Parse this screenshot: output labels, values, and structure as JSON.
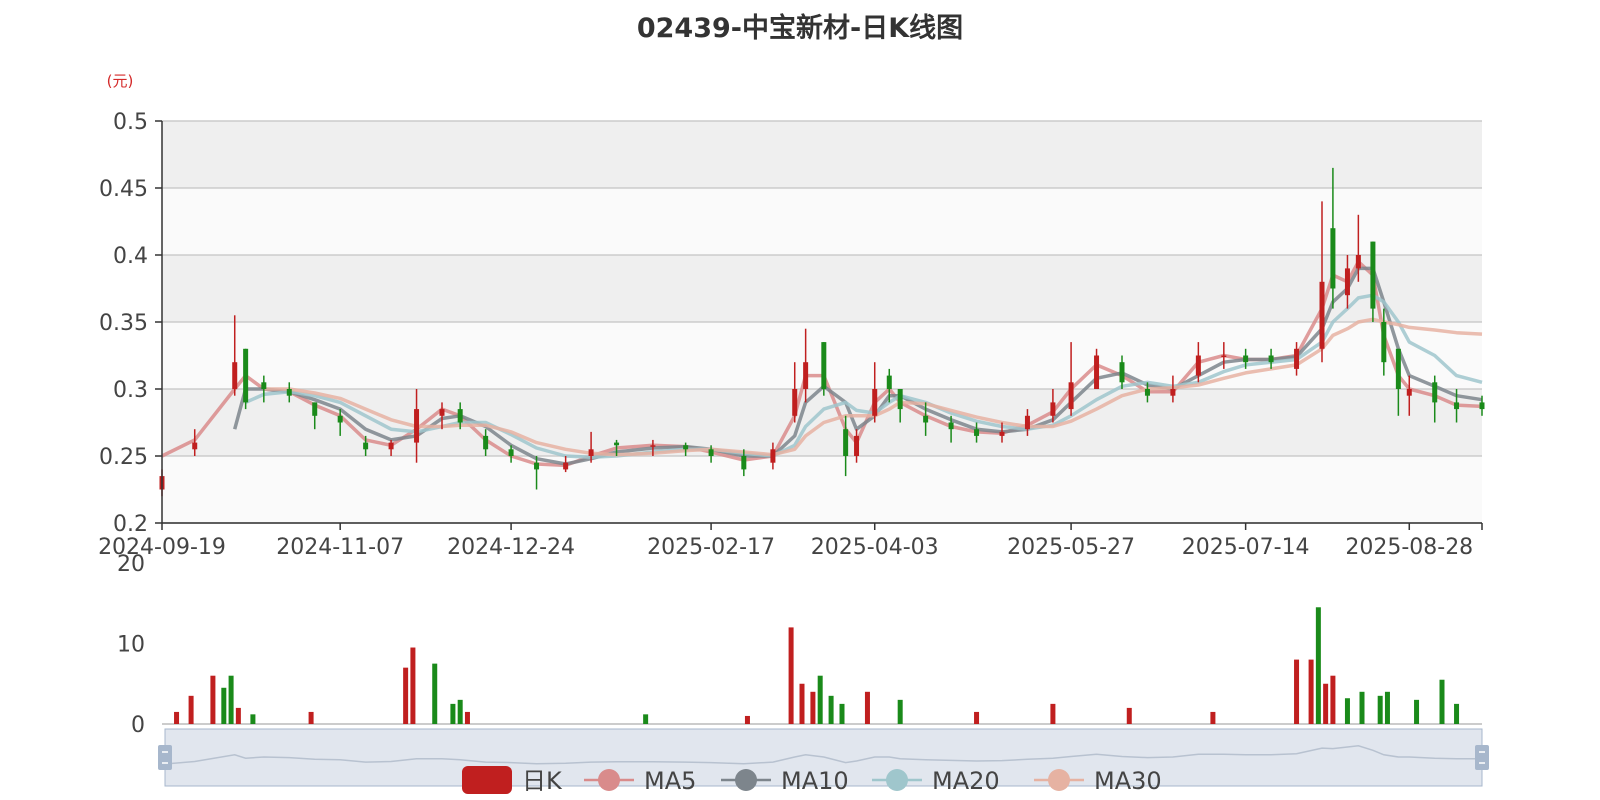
{
  "title": "02439-中宝新材-日K线图",
  "price_unit": "(元)",
  "legend": [
    "日K",
    "MA5",
    "MA10",
    "MA20",
    "MA30"
  ],
  "colors": {
    "up": "#c01f1f",
    "down": "#1a8a1a",
    "ma5": "#d98b8b",
    "ma10": "#7d858c",
    "ma20": "#9fc6cc",
    "ma30": "#e6b2a2",
    "grid": "#cccccc",
    "band_dark": "#efefef",
    "band_light": "#fafafa",
    "slider_fill": "#d9e0ea",
    "slider_handle": "#a7b7cc"
  },
  "chart_data": [
    {
      "type": "candlestick",
      "title": "02439-中宝新材-日K线图",
      "ylabel": "(元)",
      "ylim": [
        0.2,
        0.5
      ],
      "yticks": [
        "0.2",
        "0.25",
        "0.3",
        "0.35",
        "0.4",
        "0.45",
        "0.5"
      ],
      "xticks": [
        "2024-09-19",
        "2024-11-07",
        "2024-12-24",
        "2025-02-17",
        "2025-04-03",
        "2025-05-27",
        "2025-07-14",
        "2025-08-28"
      ],
      "xrange": [
        "2024-09-19",
        "2025-09-17"
      ],
      "grid": true,
      "legend_position": "bottom",
      "series": [
        {
          "name": "日K",
          "x": [
            "2024-09-19",
            "2024-09-28",
            "2024-10-09",
            "2024-10-12",
            "2024-10-17",
            "2024-10-24",
            "2024-10-31",
            "2024-11-07",
            "2024-11-14",
            "2024-11-21",
            "2024-11-28",
            "2024-12-05",
            "2024-12-10",
            "2024-12-17",
            "2024-12-24",
            "2024-12-31",
            "2025-01-08",
            "2025-01-15",
            "2025-01-22",
            "2025-02-01",
            "2025-02-10",
            "2025-02-17",
            "2025-02-26",
            "2025-03-06",
            "2025-03-12",
            "2025-03-15",
            "2025-03-20",
            "2025-03-26",
            "2025-03-29",
            "2025-04-03",
            "2025-04-07",
            "2025-04-10",
            "2025-04-17",
            "2025-04-24",
            "2025-05-01",
            "2025-05-08",
            "2025-05-15",
            "2025-05-22",
            "2025-05-27",
            "2025-06-03",
            "2025-06-10",
            "2025-06-17",
            "2025-06-24",
            "2025-07-01",
            "2025-07-08",
            "2025-07-14",
            "2025-07-21",
            "2025-07-28",
            "2025-08-04",
            "2025-08-07",
            "2025-08-11",
            "2025-08-14",
            "2025-08-18",
            "2025-08-21",
            "2025-08-25",
            "2025-08-28",
            "2025-09-04",
            "2025-09-10",
            "2025-09-17"
          ],
          "open": [
            0.225,
            0.255,
            0.3,
            0.33,
            0.305,
            0.3,
            0.29,
            0.28,
            0.26,
            0.255,
            0.26,
            0.28,
            0.285,
            0.265,
            0.255,
            0.245,
            0.24,
            0.25,
            0.26,
            0.258,
            0.258,
            0.255,
            0.25,
            0.245,
            0.28,
            0.3,
            0.335,
            0.27,
            0.25,
            0.28,
            0.31,
            0.3,
            0.28,
            0.275,
            0.27,
            0.265,
            0.27,
            0.28,
            0.285,
            0.3,
            0.32,
            0.3,
            0.295,
            0.31,
            0.325,
            0.325,
            0.325,
            0.315,
            0.33,
            0.42,
            0.37,
            0.39,
            0.41,
            0.35,
            0.33,
            0.295,
            0.305,
            0.29,
            0.29
          ],
          "close": [
            0.235,
            0.26,
            0.32,
            0.29,
            0.3,
            0.295,
            0.28,
            0.275,
            0.255,
            0.26,
            0.285,
            0.285,
            0.275,
            0.255,
            0.25,
            0.24,
            0.245,
            0.255,
            0.258,
            0.258,
            0.255,
            0.25,
            0.24,
            0.255,
            0.3,
            0.32,
            0.3,
            0.25,
            0.265,
            0.3,
            0.3,
            0.285,
            0.275,
            0.27,
            0.265,
            0.268,
            0.28,
            0.29,
            0.305,
            0.325,
            0.305,
            0.295,
            0.3,
            0.325,
            0.325,
            0.32,
            0.32,
            0.33,
            0.38,
            0.375,
            0.39,
            0.4,
            0.36,
            0.32,
            0.3,
            0.3,
            0.29,
            0.285,
            0.285
          ],
          "high": [
            0.24,
            0.27,
            0.355,
            0.33,
            0.31,
            0.305,
            0.29,
            0.285,
            0.265,
            0.262,
            0.3,
            0.29,
            0.29,
            0.27,
            0.258,
            0.25,
            0.25,
            0.268,
            0.262,
            0.262,
            0.26,
            0.258,
            0.255,
            0.26,
            0.32,
            0.345,
            0.335,
            0.28,
            0.27,
            0.32,
            0.315,
            0.3,
            0.29,
            0.28,
            0.275,
            0.275,
            0.285,
            0.3,
            0.335,
            0.33,
            0.325,
            0.305,
            0.31,
            0.335,
            0.335,
            0.33,
            0.33,
            0.335,
            0.44,
            0.465,
            0.4,
            0.43,
            0.41,
            0.36,
            0.33,
            0.31,
            0.31,
            0.3,
            0.295
          ],
          "low": [
            0.22,
            0.25,
            0.295,
            0.285,
            0.29,
            0.29,
            0.27,
            0.265,
            0.25,
            0.25,
            0.245,
            0.27,
            0.27,
            0.25,
            0.245,
            0.225,
            0.238,
            0.245,
            0.25,
            0.25,
            0.25,
            0.245,
            0.235,
            0.24,
            0.275,
            0.29,
            0.295,
            0.235,
            0.245,
            0.275,
            0.29,
            0.275,
            0.265,
            0.26,
            0.26,
            0.26,
            0.265,
            0.275,
            0.28,
            0.3,
            0.3,
            0.29,
            0.29,
            0.305,
            0.315,
            0.315,
            0.315,
            0.31,
            0.32,
            0.36,
            0.36,
            0.38,
            0.35,
            0.31,
            0.28,
            0.28,
            0.275,
            0.275,
            0.28
          ]
        },
        {
          "name": "MA5",
          "values": [
            0.25,
            0.262,
            0.3,
            0.31,
            0.3,
            0.298,
            0.288,
            0.28,
            0.262,
            0.258,
            0.27,
            0.285,
            0.28,
            0.262,
            0.25,
            0.244,
            0.243,
            0.25,
            0.256,
            0.258,
            0.257,
            0.253,
            0.247,
            0.25,
            0.28,
            0.31,
            0.31,
            0.27,
            0.26,
            0.29,
            0.3,
            0.29,
            0.28,
            0.272,
            0.268,
            0.267,
            0.273,
            0.283,
            0.3,
            0.318,
            0.31,
            0.298,
            0.298,
            0.32,
            0.325,
            0.322,
            0.322,
            0.325,
            0.36,
            0.385,
            0.38,
            0.395,
            0.385,
            0.34,
            0.31,
            0.3,
            0.295,
            0.288,
            0.287
          ]
        },
        {
          "name": "MA10",
          "values": [
            null,
            null,
            0.27,
            0.3,
            0.3,
            0.298,
            0.292,
            0.285,
            0.27,
            0.262,
            0.265,
            0.278,
            0.28,
            0.272,
            0.258,
            0.248,
            0.244,
            0.248,
            0.253,
            0.256,
            0.257,
            0.255,
            0.25,
            0.25,
            0.265,
            0.29,
            0.302,
            0.29,
            0.27,
            0.28,
            0.295,
            0.295,
            0.285,
            0.277,
            0.27,
            0.268,
            0.27,
            0.277,
            0.29,
            0.308,
            0.312,
            0.303,
            0.3,
            0.31,
            0.32,
            0.322,
            0.322,
            0.324,
            0.345,
            0.365,
            0.375,
            0.39,
            0.39,
            0.365,
            0.33,
            0.31,
            0.302,
            0.295,
            0.292
          ]
        },
        {
          "name": "MA20",
          "values": [
            null,
            null,
            null,
            0.29,
            0.296,
            0.298,
            0.295,
            0.29,
            0.28,
            0.27,
            0.268,
            0.272,
            0.275,
            0.275,
            0.266,
            0.256,
            0.25,
            0.249,
            0.25,
            0.253,
            0.255,
            0.255,
            0.252,
            0.25,
            0.258,
            0.272,
            0.285,
            0.29,
            0.284,
            0.282,
            0.29,
            0.295,
            0.29,
            0.282,
            0.276,
            0.272,
            0.27,
            0.273,
            0.28,
            0.292,
            0.302,
            0.305,
            0.302,
            0.305,
            0.313,
            0.318,
            0.32,
            0.322,
            0.335,
            0.35,
            0.36,
            0.368,
            0.37,
            0.365,
            0.35,
            0.335,
            0.325,
            0.31,
            0.305
          ]
        },
        {
          "name": "MA30",
          "values": [
            null,
            null,
            null,
            null,
            0.3,
            0.3,
            0.297,
            0.293,
            0.285,
            0.277,
            0.272,
            0.272,
            0.273,
            0.273,
            0.268,
            0.26,
            0.255,
            0.252,
            0.251,
            0.252,
            0.254,
            0.255,
            0.253,
            0.251,
            0.255,
            0.265,
            0.275,
            0.28,
            0.28,
            0.28,
            0.285,
            0.29,
            0.289,
            0.284,
            0.279,
            0.275,
            0.272,
            0.272,
            0.276,
            0.285,
            0.295,
            0.3,
            0.301,
            0.303,
            0.308,
            0.312,
            0.315,
            0.318,
            0.33,
            0.34,
            0.345,
            0.35,
            0.352,
            0.35,
            0.348,
            0.346,
            0.344,
            0.342,
            0.341
          ]
        }
      ]
    },
    {
      "type": "bar",
      "ylim": [
        0,
        20
      ],
      "yticks": [
        "0",
        "10",
        "20"
      ],
      "series": [
        {
          "name": "volume",
          "x": [
            "2024-09-23",
            "2024-09-27",
            "2024-10-03",
            "2024-10-06",
            "2024-10-08",
            "2024-10-10",
            "2024-10-14",
            "2024-10-30",
            "2024-11-25",
            "2024-11-27",
            "2024-12-03",
            "2024-12-08",
            "2024-12-10",
            "2024-12-12",
            "2025-01-30",
            "2025-02-27",
            "2025-03-11",
            "2025-03-14",
            "2025-03-17",
            "2025-03-19",
            "2025-03-22",
            "2025-03-25",
            "2025-04-01",
            "2025-04-10",
            "2025-05-01",
            "2025-05-22",
            "2025-06-12",
            "2025-07-05",
            "2025-07-28",
            "2025-08-01",
            "2025-08-03",
            "2025-08-05",
            "2025-08-07",
            "2025-08-11",
            "2025-08-15",
            "2025-08-20",
            "2025-08-22",
            "2025-08-30",
            "2025-09-06",
            "2025-09-10"
          ],
          "values": [
            1.5,
            3.5,
            6,
            4.5,
            6,
            2,
            1.2,
            1.5,
            7,
            9.5,
            7.5,
            2.5,
            3,
            1.5,
            1.2,
            1,
            12,
            5,
            4,
            6,
            3.5,
            2.5,
            4,
            3,
            1.5,
            2.5,
            2,
            1.5,
            8,
            8,
            14.5,
            5,
            6,
            3.2,
            4,
            3.5,
            4,
            3,
            5.5,
            2.5
          ],
          "direction": [
            "up",
            "up",
            "up",
            "down",
            "down",
            "up",
            "down",
            "up",
            "up",
            "up",
            "down",
            "down",
            "down",
            "up",
            "down",
            "up",
            "up",
            "up",
            "up",
            "down",
            "down",
            "down",
            "up",
            "down",
            "up",
            "up",
            "up",
            "up",
            "up",
            "up",
            "down",
            "up",
            "up",
            "down",
            "down",
            "down",
            "down",
            "down",
            "down",
            "down"
          ]
        }
      ]
    }
  ]
}
